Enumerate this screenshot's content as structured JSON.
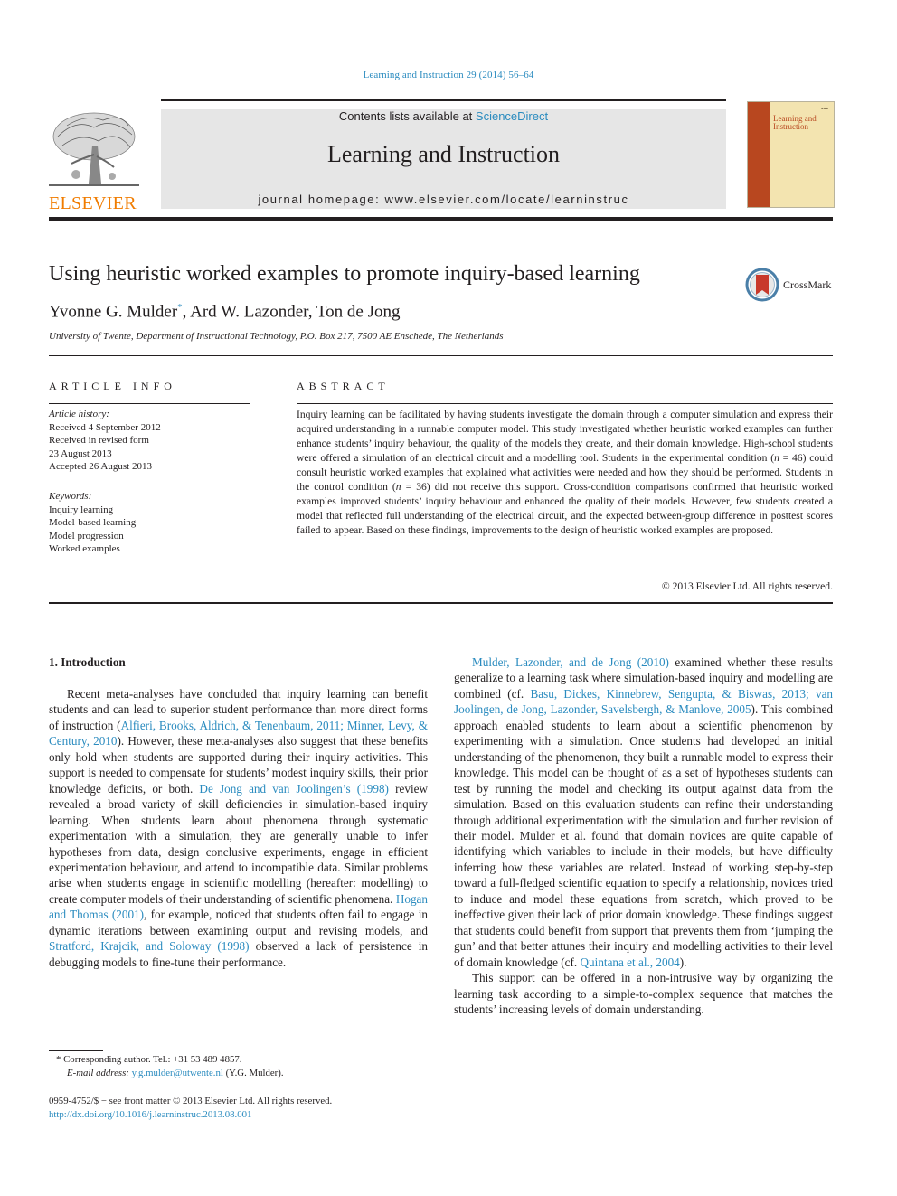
{
  "header": {
    "citation": "Learning and Instruction 29 (2014) 56–64",
    "publisher_logo_text": "ELSEVIER",
    "contents_prefix": "Contents lists available at ",
    "contents_link": "ScienceDirect",
    "journal_name": "Learning and Instruction",
    "homepage": "journal homepage: www.elsevier.com/locate/learninstruc",
    "cover_title_line1": "Learning and",
    "cover_title_line2": "Instruction",
    "colors": {
      "link": "#2a8bbf",
      "elsevier_orange": "#f07c00",
      "cover_spine": "#b8471f",
      "cover_bg": "#f3e4b0",
      "masthead_bg": "#e6e6e6"
    }
  },
  "article": {
    "title": "Using heuristic worked examples to promote inquiry-based learning",
    "crossmark_label": "CrossMark",
    "authors_part1": "Yvonne G. Mulder",
    "author_marker": "*",
    "authors_part2": ", Ard W. Lazonder, Ton de Jong",
    "affiliation": "University of Twente, Department of Instructional Technology, P.O. Box 217, 7500 AE Enschede, The Netherlands"
  },
  "article_info": {
    "label": "ARTICLE INFO",
    "history_header": "Article history:",
    "history": [
      "Received 4 September 2012",
      "Received in revised form",
      "23 August 2013",
      "Accepted 26 August 2013"
    ],
    "keywords_header": "Keywords:",
    "keywords": [
      "Inquiry learning",
      "Model-based learning",
      "Model progression",
      "Worked examples"
    ]
  },
  "abstract": {
    "label": "ABSTRACT",
    "text_part1": "Inquiry learning can be facilitated by having students investigate the domain through a computer simulation and express their acquired understanding in a runnable computer model. This study investigated whether heuristic worked examples can further enhance students’ inquiry behaviour, the quality of the models they create, and their domain knowledge. High-school students were offered a simulation of an electrical circuit and a modelling tool. Students in the experimental condition (",
    "n_exp": "n",
    "text_part2": " = 46) could consult heuristic worked examples that explained what activities were needed and how they should be performed. Students in the control condition (",
    "n_ctrl": "n",
    "text_part3": " = 36) did not receive this support. Cross-condition comparisons confirmed that heuristic worked examples improved students’ inquiry behaviour and enhanced the quality of their models. However, few students created a model that reflected full understanding of the electrical circuit, and the expected between-group difference in posttest scores failed to appear. Based on these findings, improvements to the design of heuristic worked examples are proposed.",
    "copyright": "© 2013 Elsevier Ltd. All rights reserved."
  },
  "intro": {
    "heading": "1.  Introduction",
    "p1": [
      {
        "t": "Recent meta-analyses have concluded that inquiry learning can benefit students and can lead to superior student performance than more direct forms of instruction ("
      },
      {
        "t": "Alfieri, Brooks, Aldrich, & Tenenbaum, 2011; Minner, Levy, & Century, 2010",
        "link": true
      },
      {
        "t": "). However, these meta-analyses also suggest that these benefits only hold when students are supported during their inquiry activities. This support is needed to compensate for students’ modest inquiry skills, their prior knowledge deficits, or both. "
      },
      {
        "t": "De Jong and van Joolingen’s (1998)",
        "link": true
      },
      {
        "t": " review revealed a broad variety of skill deficiencies in simulation-based inquiry learning. When students learn about phenomena through systematic experimentation with a simulation, they are generally unable to infer hypotheses from data, design conclusive experiments, engage in efficient experimentation behaviour, and attend to incompatible data. Similar problems arise when students engage in scientific modelling (hereafter: modelling) to create computer models of their understanding of scientific phenomena. "
      },
      {
        "t": "Hogan and Thomas (2001)",
        "link": true
      },
      {
        "t": ", for example, noticed that students often fail to engage in dynamic iterations between examining output and revising models, and "
      },
      {
        "t": "Stratford, Krajcik, and Soloway (1998)",
        "link": true
      },
      {
        "t": " observed a lack of persistence in debugging models to fine-tune their performance."
      }
    ],
    "p2": [
      {
        "t": "Mulder, Lazonder, and de Jong (2010)",
        "link": true
      },
      {
        "t": " examined whether these results generalize to a learning task where simulation-based inquiry and modelling are combined (cf. "
      },
      {
        "t": "Basu, Dickes, Kinnebrew, Sengupta, & Biswas, 2013; van Joolingen, de Jong, Lazonder, Savelsbergh, & Manlove, 2005",
        "link": true
      },
      {
        "t": "). This combined approach enabled students to learn about a scientific phenomenon by experimenting with a simulation. Once students had developed an initial understanding of the phenomenon, they built a runnable model to express their knowledge. This model can be thought of as a set of hypotheses students can test by running the model and checking its output against data from the simulation. Based on this evaluation students can refine their understanding through additional experimentation with the simulation and further revision of their model. Mulder et al. found that domain novices are quite capable of identifying which variables to include in their models, but have difficulty inferring how these variables are related. Instead of working step-by-step toward a full-fledged scientific equation to specify a relationship, novices tried to induce and model these equations from scratch, which proved to be ineffective given their lack of prior domain knowledge. These findings suggest that students could benefit from support that prevents them from ‘jumping the gun’ and that better attunes their inquiry and modelling activities to their level of domain knowledge (cf. "
      },
      {
        "t": "Quintana et al., 2004",
        "link": true
      },
      {
        "t": ")."
      }
    ],
    "p3": [
      {
        "t": "This support can be offered in a non-intrusive way by organizing the learning task according to a simple-to-complex sequence that matches the students’ increasing levels of domain understanding."
      }
    ]
  },
  "footnotes": {
    "marker": "*",
    "corresponding": " Corresponding author. Tel.: +31 53 489 4857.",
    "email_label": "E-mail address: ",
    "email": "y.g.mulder@utwente.nl",
    "email_suffix": " (Y.G. Mulder).",
    "issn": "0959-4752/$ − see front matter © 2013 Elsevier Ltd. All rights reserved.",
    "doi": "http://dx.doi.org/10.1016/j.learninstruc.2013.08.001"
  }
}
